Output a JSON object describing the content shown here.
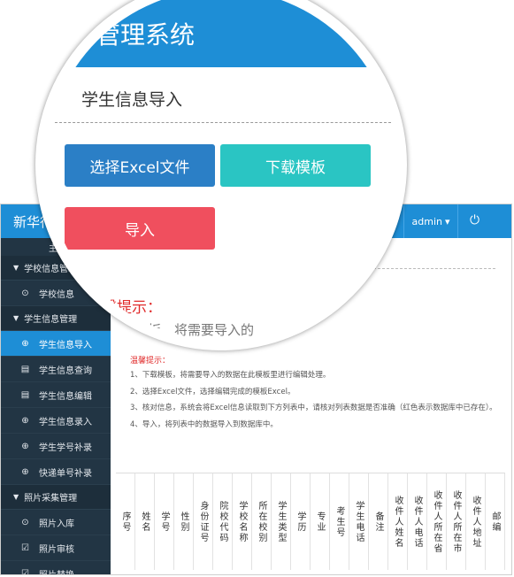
{
  "topbar": {
    "brand": "新华行",
    "link": "管理",
    "user": "admin",
    "user_caret": "▾",
    "power_icon": "⏻"
  },
  "sidebar": {
    "partial_label": "主",
    "groups": [
      {
        "title": "学校信息管理",
        "items": [
          {
            "label": "学校信息",
            "icon": "⊙",
            "active": false
          }
        ]
      },
      {
        "title": "学生信息管理",
        "items": [
          {
            "label": "学生信息导入",
            "icon": "⊕",
            "active": true
          },
          {
            "label": "学生信息查询",
            "icon": "▤",
            "active": false
          },
          {
            "label": "学生信息编辑",
            "icon": "▤",
            "active": false
          },
          {
            "label": "学生信息录入",
            "icon": "⊕",
            "active": false
          },
          {
            "label": "学生学号补录",
            "icon": "⊕",
            "active": false
          },
          {
            "label": "快递单号补录",
            "icon": "⊕",
            "active": false
          }
        ]
      },
      {
        "title": "照片采集管理",
        "items": [
          {
            "label": "照片入库",
            "icon": "⊙",
            "active": false
          },
          {
            "label": "照片审核",
            "icon": "☑",
            "active": false
          },
          {
            "label": "照片替换",
            "icon": "☑",
            "active": false
          }
        ]
      }
    ]
  },
  "tips": {
    "title": "温馨提示：",
    "lines": [
      "1、下载模板，将需要导入的数据在此模板里进行编辑处理。",
      "2、选择Excel文件，选择编辑完成的模板Excel。",
      "3、核对信息，系统会将Excel信息读取到下方列表中，请核对列表数据是否准确（红色表示数据库中已存在）。",
      "4、导入，将列表中的数据导入到数据库中。"
    ]
  },
  "table": {
    "columns": [
      "序号",
      "姓名",
      "学号",
      "性别",
      "身份证号",
      "院校代码",
      "学校名称",
      "所在校别",
      "学生类型",
      "学历",
      "专业",
      "考生号",
      "学生电话",
      "备注",
      "收件人姓名",
      "收件人电话",
      "收件人所在省",
      "收件人所在市",
      "收件人地址",
      "邮编"
    ]
  },
  "lens": {
    "title": "管理系统",
    "section": "学生信息导入",
    "btn_select": "选择Excel文件",
    "btn_download": "下载模板",
    "btn_import": "导入",
    "tip_heading": "温馨提示：",
    "tip_line": "模板，将需要导入的"
  },
  "colors": {
    "primary": "#1e8ed6",
    "teal": "#2ac5c3",
    "red": "#f04f5e",
    "sidebar": "#223544"
  }
}
